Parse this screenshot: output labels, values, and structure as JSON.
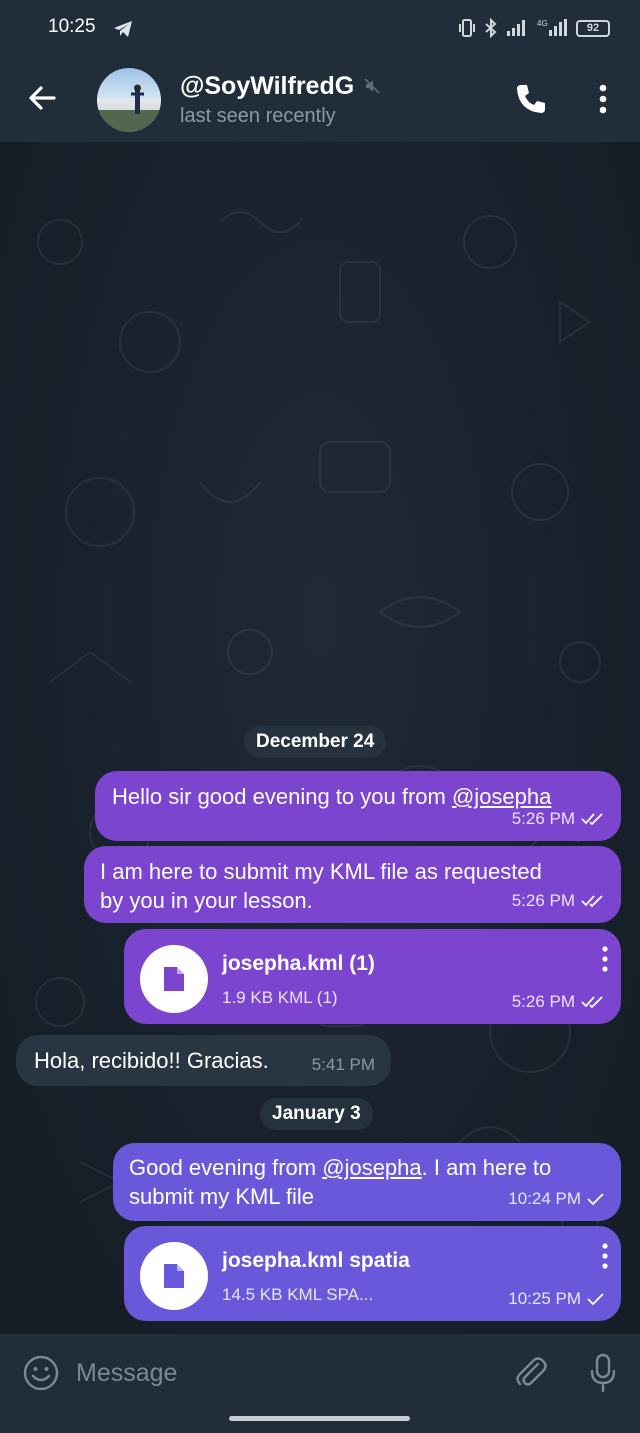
{
  "status_bar": {
    "time": "10:25",
    "battery": "92"
  },
  "header": {
    "contact_name": "@SoyWilfredG",
    "contact_status": "last seen recently"
  },
  "dates": [
    "December 24",
    "January 3"
  ],
  "messages": {
    "m1": {
      "text_before": "Hello sir good evening to you from ",
      "mention": "@josepha",
      "time": "5:26 PM"
    },
    "m2": {
      "line1": "I am here to submit my KML file as requested",
      "line2": "by you in your lesson.",
      "time": "5:26 PM"
    },
    "m3": {
      "file_name": "josepha.kml (1)",
      "file_info": "1.9 KB KML (1)",
      "time": "5:26 PM"
    },
    "m4": {
      "text": "Hola, recibido!! Gracias.",
      "time": "5:41 PM"
    },
    "m5": {
      "text_before": "Good evening from ",
      "mention": "@josepha",
      "text_after": ". I am here to",
      "line2": "submit my KML file",
      "time": "10:24 PM"
    },
    "m6": {
      "file_name": "josepha.kml spatia",
      "file_info": "14.5 KB KML SPA...",
      "time": "10:25 PM"
    }
  },
  "input": {
    "placeholder": "Message"
  },
  "colors": {
    "outgoing_read": "#7b45cf",
    "outgoing_sent": "#6a58db",
    "incoming": "#2a3542",
    "header": "#222d3a"
  }
}
